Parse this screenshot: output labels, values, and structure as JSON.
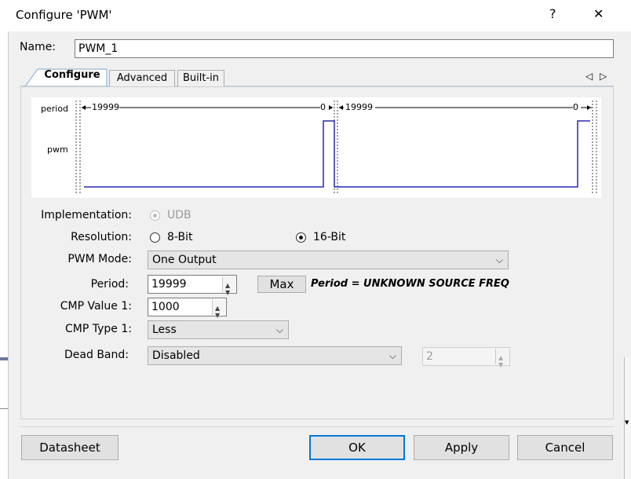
{
  "window": {
    "title": "Configure 'PWM'",
    "help_label": "?",
    "close_label": "✕"
  },
  "name": {
    "label": "Name:",
    "value": "PWM_1"
  },
  "tabs": [
    {
      "label": "Configure",
      "active": true
    },
    {
      "label": "Advanced",
      "active": false
    },
    {
      "label": "Built-in",
      "active": false
    }
  ],
  "tab_scroll": {
    "left": "◁",
    "right": "▷"
  },
  "waveform": {
    "signals": [
      "period",
      "pwm"
    ],
    "period_values": [
      "19999",
      "0",
      "19999",
      "0"
    ],
    "color": "#2828b4"
  },
  "form": {
    "implementation": {
      "label": "Implementation:",
      "value": "UDB"
    },
    "resolution": {
      "label": "Resolution:",
      "options": [
        "8-Bit",
        "16-Bit"
      ],
      "selected": "16-Bit"
    },
    "pwm_mode": {
      "label": "PWM Mode:",
      "value": "One Output"
    },
    "period": {
      "label": "Period:",
      "value": "19999",
      "max_label": "Max",
      "note": "Period = UNKNOWN SOURCE FREQ"
    },
    "cmp_value_1": {
      "label": "CMP Value 1:",
      "value": "1000"
    },
    "cmp_type_1": {
      "label": "CMP Type 1:",
      "value": "Less"
    },
    "dead_band": {
      "label": "Dead Band:",
      "value": "Disabled",
      "count": "2"
    }
  },
  "buttons": {
    "datasheet": "Datasheet",
    "ok": "OK",
    "apply": "Apply",
    "cancel": "Cancel"
  },
  "colors": {
    "accent": "#0078d7",
    "wave": "#2828b4"
  }
}
